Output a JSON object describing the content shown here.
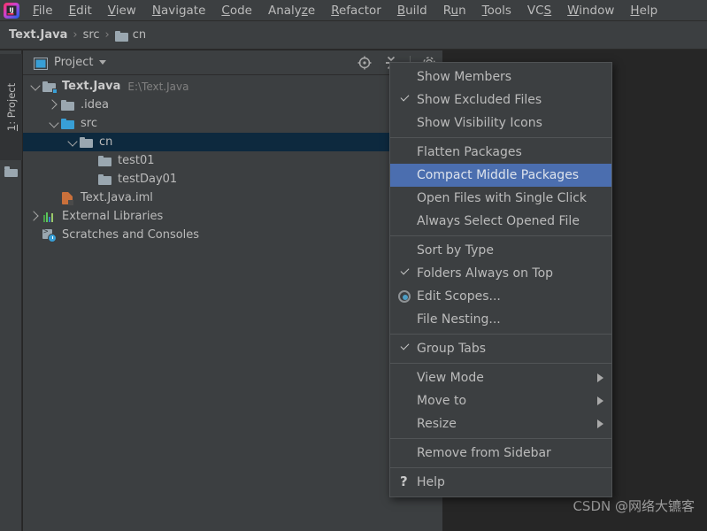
{
  "app": {
    "logo_icon": "intellij-idea-logo",
    "theme_bg": "#3C3F41",
    "editor_bg": "#262626",
    "accent_highlight": "#4B6EAF",
    "tree_selection": "#0D293E",
    "accent_blue": "#389FD6"
  },
  "menubar": {
    "items": [
      {
        "label": "File",
        "mnemonic_index": 0
      },
      {
        "label": "Edit",
        "mnemonic_index": 0
      },
      {
        "label": "View",
        "mnemonic_index": 0
      },
      {
        "label": "Navigate",
        "mnemonic_index": 0
      },
      {
        "label": "Code",
        "mnemonic_index": 0
      },
      {
        "label": "Analyze",
        "mnemonic_index": 5
      },
      {
        "label": "Refactor",
        "mnemonic_index": 0
      },
      {
        "label": "Build",
        "mnemonic_index": 0
      },
      {
        "label": "Run",
        "mnemonic_index": 1
      },
      {
        "label": "Tools",
        "mnemonic_index": 0
      },
      {
        "label": "VCS",
        "mnemonic_index": 2
      },
      {
        "label": "Window",
        "mnemonic_index": 0
      },
      {
        "label": "Help",
        "mnemonic_index": 0
      }
    ]
  },
  "breadcrumb": {
    "separator": "›",
    "items": [
      {
        "label": "Text.Java",
        "bold": true,
        "icon": null
      },
      {
        "label": "src",
        "bold": false,
        "icon": null
      },
      {
        "label": "cn",
        "bold": false,
        "icon": "folder-icon"
      }
    ]
  },
  "toolstrip": {
    "tab_label": "1: Project",
    "tab_mnemonic": "1",
    "folder_icon": "folder-icon"
  },
  "project_panel": {
    "title": "Project",
    "title_icon": "project-view-icon",
    "dropdown_icon": "chevron-down-icon",
    "toolbar": [
      {
        "name": "select-opened-file-icon",
        "title": "Select Opened File"
      },
      {
        "name": "collapse-all-icon",
        "title": "Collapse All"
      },
      {
        "name": "settings-gear-icon",
        "title": "Options"
      }
    ],
    "tree": [
      {
        "label": "Text.Java",
        "secondary": "E:\\Text.Java",
        "icon": "module-icon",
        "twisty": "expanded",
        "indent": 0,
        "bold": true,
        "selected": false
      },
      {
        "label": ".idea",
        "secondary": "",
        "icon": "folder-icon",
        "twisty": "collapsed",
        "indent": 1,
        "bold": false,
        "selected": false
      },
      {
        "label": "src",
        "secondary": "",
        "icon": "source-folder-icon",
        "twisty": "expanded",
        "indent": 1,
        "bold": false,
        "selected": false
      },
      {
        "label": "cn",
        "secondary": "",
        "icon": "folder-icon",
        "twisty": "expanded",
        "indent": 2,
        "bold": false,
        "selected": true
      },
      {
        "label": "test01",
        "secondary": "",
        "icon": "folder-icon",
        "twisty": "none",
        "indent": 3,
        "bold": false,
        "selected": false
      },
      {
        "label": "testDay01",
        "secondary": "",
        "icon": "folder-icon",
        "twisty": "none",
        "indent": 3,
        "bold": false,
        "selected": false
      },
      {
        "label": "Text.Java.iml",
        "secondary": "",
        "icon": "iml-file-icon",
        "twisty": "none",
        "indent": 1,
        "bold": false,
        "selected": false
      },
      {
        "label": "External Libraries",
        "secondary": "",
        "icon": "external-libraries-icon",
        "twisty": "collapsed",
        "indent": 0,
        "bold": false,
        "selected": false
      },
      {
        "label": "Scratches and Consoles",
        "secondary": "",
        "icon": "scratches-icon",
        "twisty": "none",
        "indent": 0,
        "bold": false,
        "selected": false
      }
    ]
  },
  "context_menu": {
    "groups": [
      [
        {
          "label": "Show Members",
          "marker": "none",
          "submenu": false,
          "highlighted": false
        },
        {
          "label": "Show Excluded Files",
          "marker": "check",
          "submenu": false,
          "highlighted": false
        },
        {
          "label": "Show Visibility Icons",
          "marker": "none",
          "submenu": false,
          "highlighted": false
        }
      ],
      [
        {
          "label": "Flatten Packages",
          "marker": "none",
          "submenu": false,
          "highlighted": false
        },
        {
          "label": "Compact Middle Packages",
          "marker": "none",
          "submenu": false,
          "highlighted": true
        },
        {
          "label": "Open Files with Single Click",
          "marker": "none",
          "submenu": false,
          "highlighted": false
        },
        {
          "label": "Always Select Opened File",
          "marker": "none",
          "submenu": false,
          "highlighted": false
        }
      ],
      [
        {
          "label": "Sort by Type",
          "marker": "none",
          "submenu": false,
          "highlighted": false
        },
        {
          "label": "Folders Always on Top",
          "marker": "check",
          "submenu": false,
          "highlighted": false
        },
        {
          "label": "Edit Scopes...",
          "marker": "radio",
          "submenu": false,
          "highlighted": false
        },
        {
          "label": "File Nesting...",
          "marker": "none",
          "submenu": false,
          "highlighted": false
        }
      ],
      [
        {
          "label": "Group Tabs",
          "marker": "check",
          "submenu": false,
          "highlighted": false
        }
      ],
      [
        {
          "label": "View Mode",
          "marker": "none",
          "submenu": true,
          "highlighted": false
        },
        {
          "label": "Move to",
          "marker": "none",
          "submenu": true,
          "highlighted": false
        },
        {
          "label": "Resize",
          "marker": "none",
          "submenu": true,
          "highlighted": false
        }
      ],
      [
        {
          "label": "Remove from Sidebar",
          "marker": "none",
          "submenu": false,
          "highlighted": false
        }
      ],
      [
        {
          "label": "Help",
          "marker": "question",
          "submenu": false,
          "highlighted": false
        }
      ]
    ]
  },
  "editor": {
    "watermark": "CSDN @网络大镳客"
  }
}
